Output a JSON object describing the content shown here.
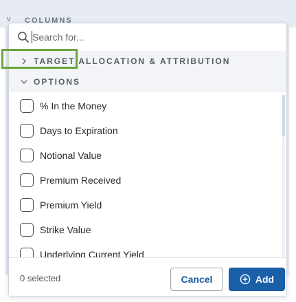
{
  "background": {
    "header_title": "COLUMNS"
  },
  "search": {
    "placeholder": "Search for...",
    "icon": "search-icon"
  },
  "groups": [
    {
      "label": "TARGET ALLOCATION & ATTRIBUTION",
      "expanded": false
    },
    {
      "label": "OPTIONS",
      "expanded": true
    }
  ],
  "options": {
    "items": [
      {
        "label": "% In the Money",
        "checked": false
      },
      {
        "label": "Days to Expiration",
        "checked": false
      },
      {
        "label": "Notional Value",
        "checked": false
      },
      {
        "label": "Premium Received",
        "checked": false
      },
      {
        "label": "Premium Yield",
        "checked": false
      },
      {
        "label": "Strike Value",
        "checked": false
      },
      {
        "label": "Underlying Current Yield",
        "checked": false
      }
    ]
  },
  "footer": {
    "selected_text": "0 selected",
    "cancel_label": "Cancel",
    "add_label": "Add"
  },
  "colors": {
    "accent": "#1b5fa8",
    "highlight": "#6aa53a"
  }
}
